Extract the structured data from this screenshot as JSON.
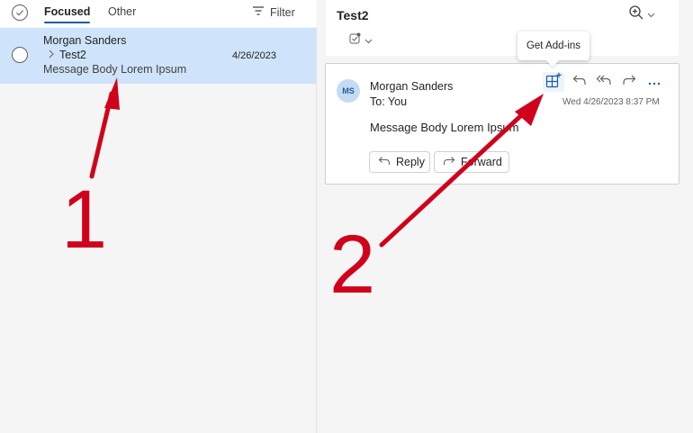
{
  "list": {
    "tab_focused": "Focused",
    "tab_other": "Other",
    "filter_label": "Filter",
    "item": {
      "sender": "Morgan Sanders",
      "subject": "Test2",
      "date": "4/26/2023",
      "preview": "Message Body Lorem Ipsum"
    }
  },
  "reading": {
    "subject": "Test2",
    "tooltip": "Get Add-ins",
    "message": {
      "avatar_initials": "MS",
      "sender": "Morgan Sanders",
      "to_line": "To:  You",
      "datetime": "Wed 4/26/2023 8:37 PM",
      "body": "Message Body Lorem Ipsum",
      "reply_label": "Reply",
      "forward_label": "Forward"
    }
  },
  "annotations": {
    "label_1": "1",
    "label_2": "2"
  },
  "icons": {
    "select_all": "circle-check-icon",
    "filter": "filter-lines-icon",
    "zoom": "zoom-in-icon",
    "tag": "tag-icon",
    "add_ins": "apps-grid-plus-icon",
    "reply": "reply-arrow-icon",
    "reply_all": "reply-all-icon",
    "forward": "forward-arrow-icon",
    "more": "more-dots-icon"
  },
  "colors": {
    "selected_row": "#cfe4fa",
    "accent": "#1f5aa6",
    "annotation": "#d0021b",
    "avatar_bg": "#c4dcf3"
  }
}
